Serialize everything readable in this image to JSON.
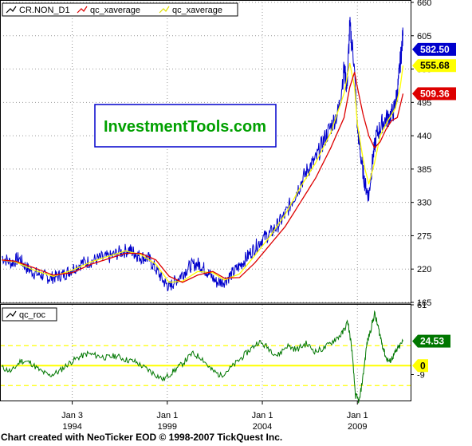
{
  "footer": "Chart created with NeoTicker EOD © 1998-2007 TickQuest Inc.",
  "watermark": "InvestmentTools.com",
  "colors": {
    "price": "#0000cc",
    "xavg_fast": "#ffff00",
    "xavg_slow": "#dd0000",
    "roc": "#007700",
    "grid": "#999999",
    "ref_line": "#ffff00"
  },
  "chart_data": [
    {
      "type": "line",
      "panel": "price",
      "legend": [
        {
          "name": "CR.NON_D1",
          "icon": "line-icon-black"
        },
        {
          "name": "qc_xaverage",
          "icon": "line-icon-red"
        },
        {
          "name": "qc_xaverage",
          "icon": "line-icon-yellow"
        }
      ],
      "ylim": [
        165,
        660
      ],
      "yticks": [
        165,
        220,
        275,
        330,
        385,
        440,
        495,
        550,
        605,
        660
      ],
      "x_range": [
        1990.2,
        2011.8
      ],
      "x_ticks": [
        {
          "x": 1994.0,
          "label1": "Jan 3",
          "label2": "1994"
        },
        {
          "x": 1999.0,
          "label1": "Jan 1",
          "label2": "1999"
        },
        {
          "x": 2004.0,
          "label1": "Jan 1",
          "label2": "2004"
        },
        {
          "x": 2009.0,
          "label1": "Jan 1",
          "label2": "2009"
        }
      ],
      "series": [
        {
          "name": "CR.NON_D1",
          "x": [
            1990.3,
            1990.8,
            1991.2,
            1991.6,
            1992.0,
            1992.4,
            1992.8,
            1993.2,
            1993.6,
            1994.0,
            1994.5,
            1995.0,
            1995.5,
            1996.0,
            1996.5,
            1997.0,
            1997.3,
            1997.6,
            1998.0,
            1998.4,
            1998.8,
            1999.1,
            1999.4,
            1999.8,
            2000.2,
            2000.6,
            2000.9,
            2001.2,
            2001.6,
            2002.0,
            2002.4,
            2002.8,
            2003.2,
            2003.6,
            2004.0,
            2004.4,
            2004.8,
            2005.2,
            2005.6,
            2006.0,
            2006.4,
            2006.8,
            2007.2,
            2007.6,
            2008.0,
            2008.3,
            2008.45,
            2008.6,
            2008.8,
            2009.0,
            2009.2,
            2009.4,
            2009.6,
            2009.8,
            2010.0,
            2010.3,
            2010.6,
            2010.9,
            2011.1,
            2011.25,
            2011.4
          ],
          "y": [
            240,
            230,
            238,
            222,
            214,
            210,
            205,
            208,
            212,
            220,
            230,
            233,
            238,
            240,
            248,
            252,
            246,
            240,
            238,
            220,
            200,
            190,
            200,
            212,
            225,
            229,
            222,
            212,
            198,
            200,
            212,
            225,
            240,
            255,
            270,
            278,
            292,
            310,
            335,
            360,
            385,
            400,
            430,
            455,
            480,
            550,
            520,
            620,
            570,
            455,
            400,
            360,
            340,
            400,
            440,
            460,
            470,
            480,
            510,
            560,
            605
          ],
          "last_value": "582.50"
        },
        {
          "name": "qc_xaverage",
          "x": [
            1990.3,
            1991.0,
            1992.0,
            1993.0,
            1994.0,
            1995.0,
            1996.0,
            1996.8,
            1997.6,
            1998.4,
            1999.1,
            1999.8,
            2000.6,
            2001.4,
            2002.0,
            2002.8,
            2003.6,
            2004.4,
            2005.2,
            2006.0,
            2006.8,
            2007.6,
            2008.3,
            2008.6,
            2008.85,
            2009.0,
            2009.2,
            2009.4,
            2009.6,
            2009.9,
            2010.2,
            2010.6,
            2011.0,
            2011.25,
            2011.4
          ],
          "y": [
            235,
            232,
            218,
            208,
            218,
            232,
            242,
            250,
            244,
            228,
            198,
            200,
            216,
            214,
            202,
            212,
            242,
            274,
            310,
            355,
            395,
            445,
            510,
            560,
            520,
            460,
            420,
            385,
            360,
            395,
            440,
            465,
            485,
            520,
            555.68
          ],
          "last_value": "555.68"
        },
        {
          "name": "qc_xaverage",
          "x": [
            1990.3,
            1991.0,
            1992.0,
            1993.0,
            1994.0,
            1995.0,
            1996.0,
            1996.8,
            1997.6,
            1998.4,
            1999.1,
            1999.8,
            2000.6,
            2001.4,
            2002.0,
            2002.8,
            2003.6,
            2004.4,
            2005.2,
            2006.0,
            2006.8,
            2007.6,
            2008.3,
            2008.6,
            2008.85,
            2009.0,
            2009.3,
            2009.6,
            2009.9,
            2010.2,
            2010.5,
            2010.8,
            2011.1,
            2011.4
          ],
          "y": [
            235,
            233,
            222,
            210,
            214,
            228,
            238,
            246,
            246,
            235,
            208,
            198,
            210,
            216,
            205,
            206,
            230,
            260,
            290,
            330,
            370,
            420,
            470,
            520,
            545,
            520,
            475,
            440,
            420,
            430,
            450,
            465,
            470,
            509.36
          ],
          "last_value": "509.36"
        }
      ]
    },
    {
      "type": "line",
      "panel": "oscillator",
      "legend": [
        {
          "name": "qc_roc",
          "icon": "line-icon-black"
        }
      ],
      "ylim": [
        -35,
        61
      ],
      "yticks": [
        -9,
        61
      ],
      "reference_lines": [
        -20,
        0,
        20
      ],
      "series": [
        {
          "name": "qc_roc",
          "x": [
            1990.3,
            1990.8,
            1991.3,
            1991.8,
            1992.3,
            1992.8,
            1993.3,
            1993.8,
            1994.3,
            1994.8,
            1995.3,
            1995.8,
            1996.3,
            1996.8,
            1997.3,
            1997.8,
            1998.3,
            1998.8,
            1999.3,
            1999.8,
            2000.3,
            2000.8,
            2001.3,
            2001.8,
            2002.3,
            2002.8,
            2003.3,
            2003.8,
            2004.3,
            2004.8,
            2005.3,
            2005.8,
            2006.3,
            2006.8,
            2007.3,
            2007.8,
            2008.2,
            2008.5,
            2008.7,
            2008.9,
            2009.1,
            2009.3,
            2009.5,
            2009.7,
            2009.9,
            2010.1,
            2010.3,
            2010.5,
            2010.7,
            2010.9,
            2011.1,
            2011.4
          ],
          "y": [
            -2,
            -6,
            5,
            3,
            -5,
            -10,
            -6,
            2,
            8,
            12,
            10,
            8,
            10,
            6,
            4,
            -2,
            -8,
            -14,
            -6,
            2,
            12,
            8,
            -4,
            -10,
            -3,
            6,
            15,
            24,
            18,
            10,
            20,
            16,
            22,
            14,
            18,
            26,
            32,
            44,
            18,
            -30,
            -36,
            -10,
            22,
            36,
            52,
            38,
            22,
            8,
            4,
            10,
            16,
            24.53
          ],
          "last_value": "24.53"
        }
      ]
    }
  ]
}
